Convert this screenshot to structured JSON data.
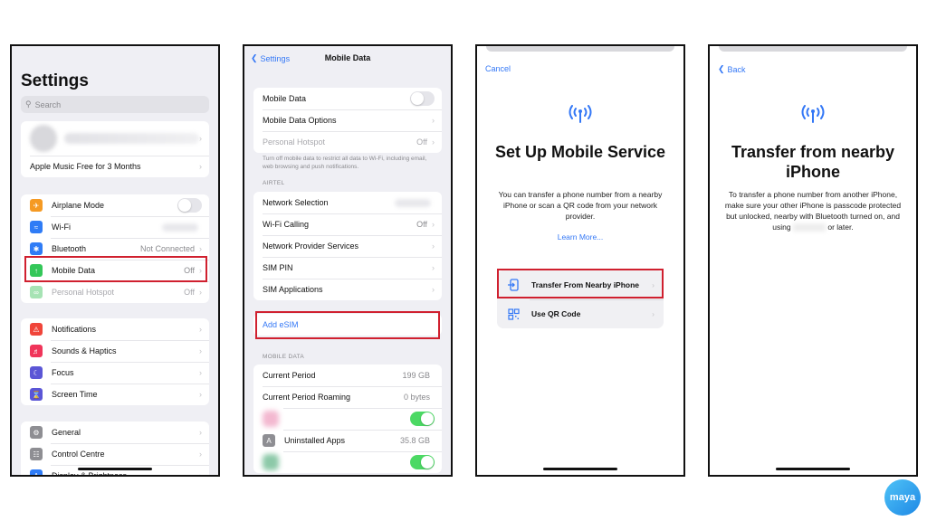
{
  "panel1": {
    "title": "Settings",
    "search_placeholder": "Search",
    "profile_row_label": "Apple Music Free for 3 Months",
    "group_connectivity": [
      {
        "label": "Airplane Mode",
        "icon": "airplane-icon",
        "color": "#f59a23",
        "control": "toggle-off"
      },
      {
        "label": "Wi-Fi",
        "icon": "wifi-icon",
        "color": "#2f7cf6",
        "value": ""
      },
      {
        "label": "Bluetooth",
        "icon": "bluetooth-icon",
        "color": "#2f7cf6",
        "value": "Not Connected"
      },
      {
        "label": "Mobile Data",
        "icon": "antenna-icon",
        "color": "#34c759",
        "value": "Off"
      },
      {
        "label": "Personal Hotspot",
        "icon": "hotspot-icon",
        "color": "#a6e3b4",
        "value": "Off"
      }
    ],
    "group_notifications": [
      {
        "label": "Notifications",
        "icon": "notifications-icon",
        "color": "#f0453a"
      },
      {
        "label": "Sounds & Haptics",
        "icon": "sound-icon",
        "color": "#f0355a"
      },
      {
        "label": "Focus",
        "icon": "moon-icon",
        "color": "#5b56d6"
      },
      {
        "label": "Screen Time",
        "icon": "hourglass-icon",
        "color": "#5b56d6"
      }
    ],
    "group_general": [
      {
        "label": "General",
        "icon": "gear-icon",
        "color": "#8e8e93"
      },
      {
        "label": "Control Centre",
        "icon": "control-centre-icon",
        "color": "#8e8e93"
      },
      {
        "label": "Display & Brightness",
        "icon": "display-icon",
        "color": "#2f7cf6"
      }
    ]
  },
  "panel2": {
    "back_label": "Settings",
    "title": "Mobile Data",
    "group1": [
      {
        "label": "Mobile Data",
        "control": "toggle-off"
      },
      {
        "label": "Mobile Data Options"
      },
      {
        "label": "Personal Hotspot",
        "value": "Off",
        "dim": true
      }
    ],
    "footnote": "Turn off mobile data to restrict all data to Wi-Fi, including email, web browsing and push notifications.",
    "carrier_header": "AIRTEL",
    "group2": [
      {
        "label": "Network Selection",
        "value": ""
      },
      {
        "label": "Wi-Fi Calling",
        "value": "Off"
      },
      {
        "label": "Network Provider Services"
      },
      {
        "label": "SIM PIN"
      },
      {
        "label": "SIM Applications"
      }
    ],
    "add_esim_label": "Add eSIM",
    "mobile_data_header": "MOBILE DATA",
    "usage": [
      {
        "label": "Current Period",
        "value": "199 GB"
      },
      {
        "label": "Current Period Roaming",
        "value": "0 bytes"
      },
      {
        "label": "",
        "control": "toggle-on",
        "blurred": true
      },
      {
        "label": "Uninstalled Apps",
        "value": "35.8 GB"
      },
      {
        "label": "",
        "control": "toggle-on",
        "blurred": true
      }
    ]
  },
  "panel3": {
    "cancel_label": "Cancel",
    "title": "Set Up Mobile Service",
    "description": "You can transfer a phone number from a nearby iPhone or scan a QR code from your network provider.",
    "learn_more": "Learn More...",
    "options": [
      {
        "label": "Transfer From Nearby iPhone",
        "icon": "transfer-icon"
      },
      {
        "label": "Use QR Code",
        "icon": "qr-code-icon"
      }
    ]
  },
  "panel4": {
    "back_label": "Back",
    "title": "Transfer from nearby iPhone",
    "description_before": "To transfer a phone number from another iPhone, make sure your other iPhone is passcode protected but unlocked, nearby with Bluetooth turned on, and using",
    "description_after": "or later."
  },
  "brand": {
    "logo_text": "maya"
  },
  "colors": {
    "accent": "#3478f6",
    "highlight": "#d0202f",
    "toggle_on": "#4cd964"
  }
}
